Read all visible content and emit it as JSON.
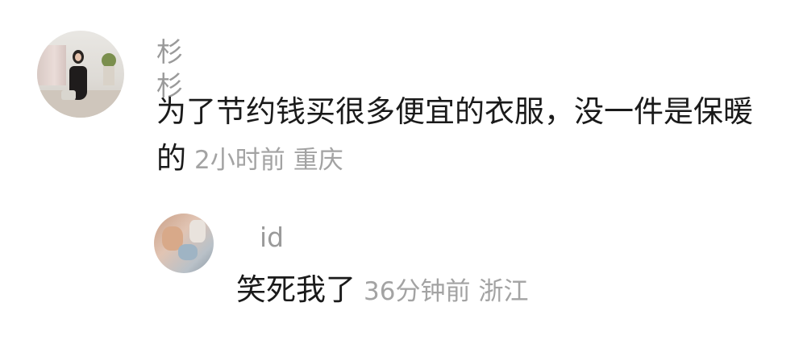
{
  "comment": {
    "username": "杉杉",
    "text": "为了节约钱买很多便宜的衣服，没一件是保暖的",
    "time": "2小时前",
    "location": "重庆",
    "avatar_icon": "user-avatar-photo"
  },
  "reply": {
    "username": "id",
    "text": "笑死我了",
    "time": "36分钟前",
    "location": "浙江",
    "avatar_icon": "user-avatar-photo"
  },
  "colors": {
    "text_primary": "#1a1a1a",
    "text_secondary": "#9a9a9a",
    "background": "#ffffff"
  }
}
